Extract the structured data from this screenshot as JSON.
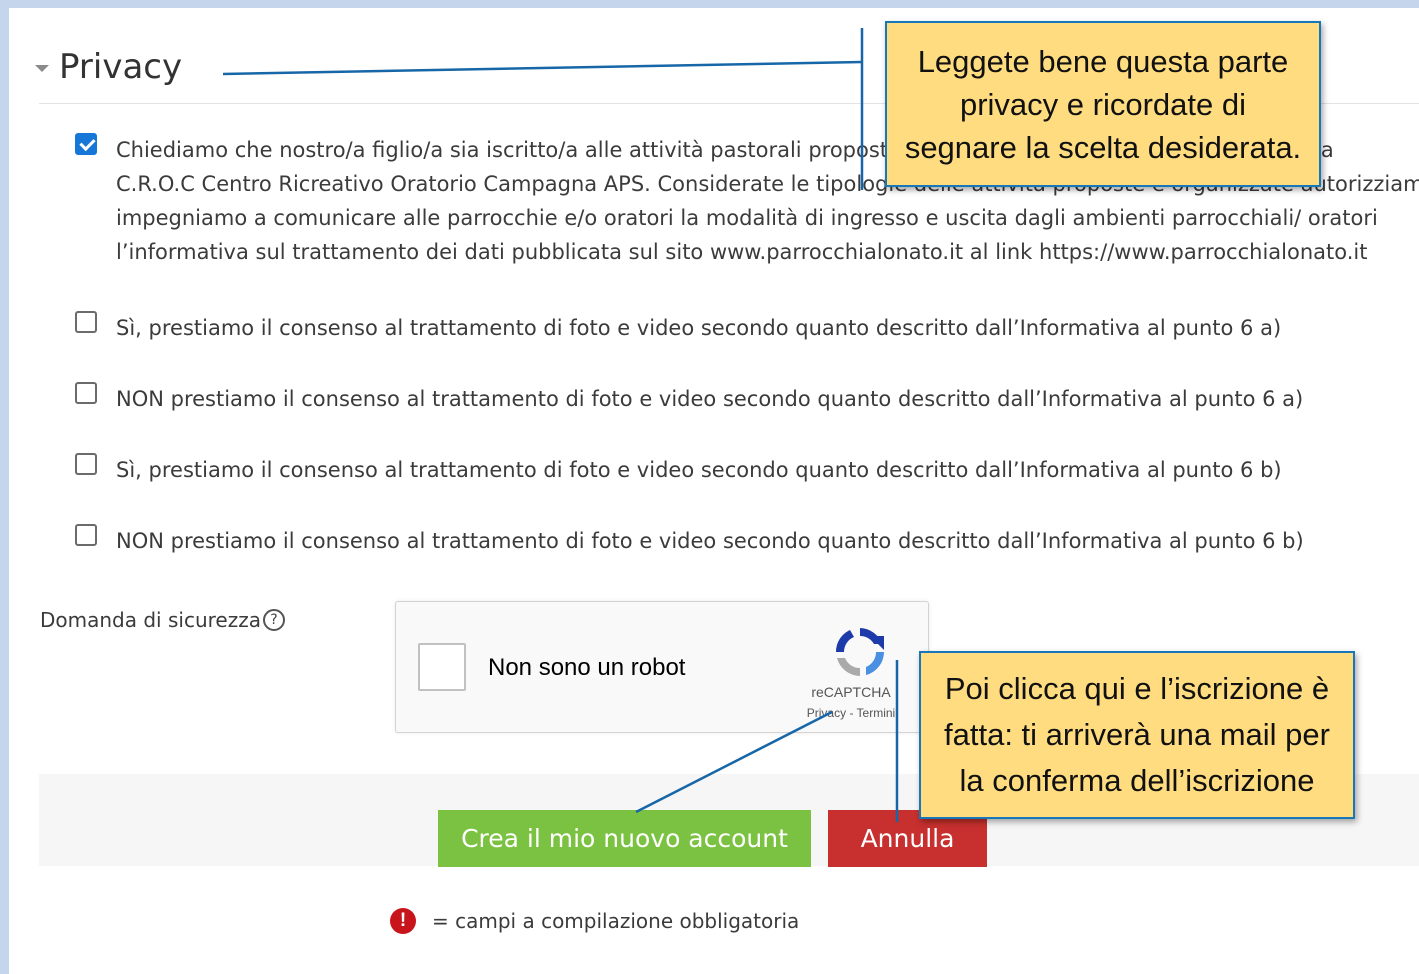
{
  "privacy": {
    "title": "Privacy",
    "consent_paragraph": {
      "line1": "Chiediamo che nostro/a figlio/a sia iscritto/a alle attività pastorali proposte dalla Parrocchia di San Giovanni Battista",
      "line2": "C.R.O.C Centro Ricreativo Oratorio Campagna APS. Considerate le tipologie delle attività proposte e organizzate autorizziamo",
      "line3": "impegniamo a comunicare alle parrocchie e/o oratori la modalità di ingresso e uscita dagli ambienti parrocchiali/ oratori",
      "line4": "l’informativa sul trattamento dei dati pubblicata sul sito www.parrocchialonato.it al link https://www.parrocchialonato.it"
    },
    "options": [
      "Sì, prestiamo il consenso al trattamento di foto e video secondo quanto descritto dall’Informativa al punto 6 a)",
      "NON prestiamo il consenso al trattamento di foto e video secondo quanto descritto dall’Informativa al punto 6 a)",
      "Sì, prestiamo il consenso al trattamento di foto e video secondo quanto descritto dall’Informativa al punto 6 b)",
      "NON prestiamo il consenso al trattamento di foto e video secondo quanto descritto dall’Informativa al punto 6 b)"
    ],
    "checked": [
      true,
      false,
      false,
      false,
      false
    ]
  },
  "security": {
    "label": "Domanda di sicurezza",
    "help_icon": "?",
    "recaptcha": {
      "label": "Non sono un robot",
      "brand": "reCAPTCHA",
      "links": "Privacy - Termini",
      "logo_icon": "recaptcha-logo-icon"
    }
  },
  "buttons": {
    "create": "Crea il mio nuovo account",
    "cancel": "Annulla"
  },
  "required_note": {
    "icon": "!",
    "text": "= campi a compilazione obbligatoria"
  },
  "callouts": {
    "privacy_note": "Leggete bene questa parte\nprivacy e ricordate di\nsegnare la scelta desiderata.",
    "submit_note": "Poi clicca qui e l’iscrizione è\nfatta: ti arriverà una mail per\nla conferma dell’iscrizione"
  },
  "colors": {
    "frame": "#c5d6ec",
    "create_button": "#7cc242",
    "cancel_button": "#c7302e",
    "callout_fill": "#fedc7f",
    "callout_border": "#1777b8",
    "checkbox_checked": "#1777d8",
    "required_icon": "#c8141b"
  }
}
